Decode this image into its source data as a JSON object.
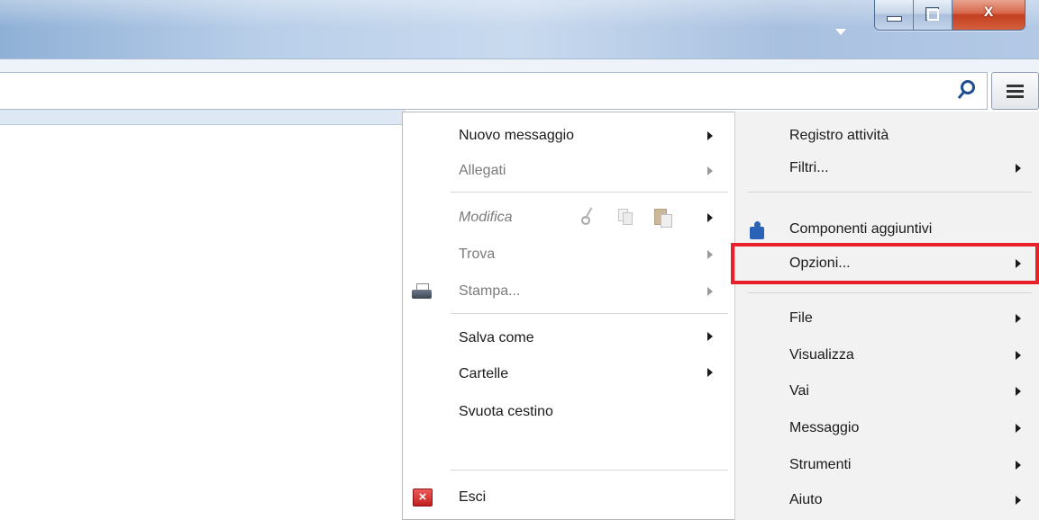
{
  "window": {
    "controls": {
      "minimize": "minimize",
      "maximize": "restore",
      "close": "x"
    },
    "accent_close_color": "#c43f1f"
  },
  "toolbar": {
    "search_placeholder": "",
    "search_icon": "search-icon",
    "menu_icon": "hamburger-menu-icon"
  },
  "left_menu": {
    "items": [
      {
        "label": "Nuovo messaggio",
        "enabled": true,
        "submenu": true
      },
      {
        "label": "Allegati",
        "enabled": false,
        "submenu": true
      },
      {
        "label": "Modifica",
        "enabled": false,
        "submenu": true,
        "italic": true,
        "icons": [
          "scissors-icon",
          "copy-icon",
          "paste-icon"
        ]
      },
      {
        "label": "Trova",
        "enabled": false,
        "submenu": true
      },
      {
        "label": "Stampa...",
        "enabled": false,
        "submenu": true,
        "icon": "printer-icon"
      },
      {
        "label": "Salva come",
        "enabled": true,
        "submenu": true
      },
      {
        "label": "Cartelle",
        "enabled": true,
        "submenu": true
      },
      {
        "label": "Svuota cestino",
        "enabled": true,
        "submenu": false
      },
      {
        "label": "Esci",
        "enabled": true,
        "submenu": false,
        "icon": "exit-icon",
        "icon_glyph": "×"
      }
    ]
  },
  "right_menu": {
    "items": [
      {
        "label": "Registro attività",
        "submenu": false
      },
      {
        "label": "Filtri...",
        "submenu": true
      },
      {
        "label": "Componenti aggiuntivi",
        "submenu": false,
        "icon": "puzzle-icon"
      },
      {
        "label": "Opzioni...",
        "submenu": true,
        "highlighted": true
      },
      {
        "label": "File",
        "submenu": true
      },
      {
        "label": "Visualizza",
        "submenu": true
      },
      {
        "label": "Vai",
        "submenu": true
      },
      {
        "label": "Messaggio",
        "submenu": true
      },
      {
        "label": "Strumenti",
        "submenu": true
      },
      {
        "label": "Aiuto",
        "submenu": true
      }
    ],
    "highlight_color": "#e8202a"
  }
}
